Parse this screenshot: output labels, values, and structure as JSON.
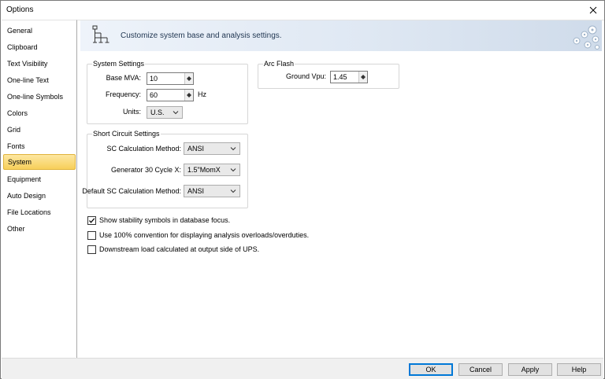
{
  "window": {
    "title": "Options"
  },
  "sidebar": {
    "items": [
      {
        "label": "General"
      },
      {
        "label": "Clipboard"
      },
      {
        "label": "Text Visibility"
      },
      {
        "label": "One-line Text"
      },
      {
        "label": "One-line Symbols"
      },
      {
        "label": "Colors"
      },
      {
        "label": "Grid"
      },
      {
        "label": "Fonts"
      },
      {
        "label": "System",
        "selected": true
      },
      {
        "label": "Equipment"
      },
      {
        "label": "Auto Design"
      },
      {
        "label": "File Locations"
      },
      {
        "label": "Other"
      }
    ]
  },
  "banner": {
    "text": "Customize system base and analysis settings.",
    "icon": "system-tree-icon",
    "decoration": "gears-icon"
  },
  "system_settings": {
    "legend": "System Settings",
    "base_mva_label": "Base MVA:",
    "base_mva_value": "10",
    "frequency_label": "Frequency:",
    "frequency_value": "60",
    "frequency_unit": "Hz",
    "units_label": "Units:",
    "units_value": "U.S."
  },
  "arc_flash": {
    "legend": "Arc Flash",
    "ground_vpu_label": "Ground Vpu:",
    "ground_vpu_value": "1.45"
  },
  "short_circuit": {
    "legend": "Short Circuit Settings",
    "sc_method_label": "SC Calculation Method:",
    "sc_method_value": "ANSI",
    "gen_30_label": "Generator 30 Cycle X:",
    "gen_30_value": "1.5\"MomX",
    "default_sc_label": "Default SC Calculation Method:",
    "default_sc_value": "ANSI"
  },
  "checkboxes": [
    {
      "label": "Show stability symbols in database focus.",
      "checked": true
    },
    {
      "label": "Use 100% convention for displaying analysis overloads/overduties.",
      "checked": false
    },
    {
      "label": "Downstream load calculated at output side of UPS.",
      "checked": false
    }
  ],
  "buttons": {
    "ok": "OK",
    "cancel": "Cancel",
    "apply": "Apply",
    "help": "Help"
  },
  "colors": {
    "selected_bg": "#f7cf5a",
    "default_button_border": "#0078d7",
    "banner_text": "#1f3550"
  }
}
